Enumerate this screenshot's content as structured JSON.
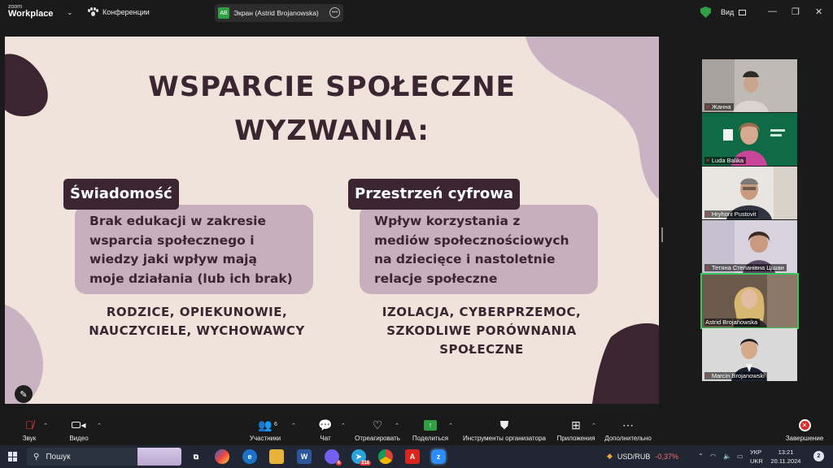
{
  "app": {
    "logo_line1": "zoom",
    "logo_line2": "Workplace",
    "meeting_menu": "Конференции",
    "screen_tab_initials": "AB",
    "screen_tab_label": "Экран (Astrid Brojanowska)",
    "view_label": "Вид",
    "minimize": "—",
    "restore": "❐",
    "close": "✕"
  },
  "slide": {
    "title_line1": "WSPARCIE SPOŁECZNE",
    "title_line2": "WYZWANIA:",
    "left_tag": "Świadomość",
    "left_card_lines": [
      "Brak edukacji w zakresie",
      "wsparcia społecznego i",
      "wiedzy jaki wpływ mają",
      "moje działania (lub ich brak)"
    ],
    "left_caps_lines": [
      "RODZICE, OPIEKUNOWIE,",
      "NAUCZYCIELE, WYCHOWAWCY"
    ],
    "right_tag": "Przestrzeń cyfrowa",
    "right_card_lines": [
      "Wpływ korzystania z",
      "mediów społecznościowych",
      "na dziecięce i nastoletnie",
      "relacje społeczne"
    ],
    "right_caps_lines": [
      "IZOLACJA, CYBERPRZEMOC,",
      "SZKODLIWE PORÓWNANIA",
      "SPOŁECZNE"
    ],
    "colors": {
      "background": "#efe3db",
      "dark": "#3b2530",
      "card": "#c7afbe",
      "blob_light": "#c9b3c2",
      "blob_dark": "#3b2530"
    }
  },
  "participants": [
    {
      "name": "Жанна",
      "muted": true,
      "active": false
    },
    {
      "name": "Luda Balika",
      "muted": true,
      "active": false
    },
    {
      "name": "Hryhorii Pustovit",
      "muted": true,
      "active": false
    },
    {
      "name": "Тетяна Степанівна Цішан",
      "muted": true,
      "active": false
    },
    {
      "name": "Astrid Brojanowska",
      "muted": false,
      "active": true
    },
    {
      "name": "Marcin Brojanowski",
      "muted": true,
      "active": false
    }
  ],
  "toolbar": {
    "audio": "Звук",
    "video": "Видео",
    "participants": "Участники",
    "participants_count": "6",
    "chat": "Чат",
    "react": "Отреагировать",
    "share": "Поделиться",
    "host_tools": "Инструменты организатора",
    "apps": "Приложения",
    "more": "Дополнительно",
    "end": "Завершение"
  },
  "taskbar": {
    "search_placeholder": "Пошук",
    "ticker_symbol": "USD/RUB",
    "ticker_change": "-0,37%",
    "lang_line1": "УКР",
    "lang_line2": "UKR",
    "time": "13:21",
    "date": "20.11.2024",
    "notifications": "2",
    "viber_badge": "4",
    "telegram_badge": "318"
  }
}
